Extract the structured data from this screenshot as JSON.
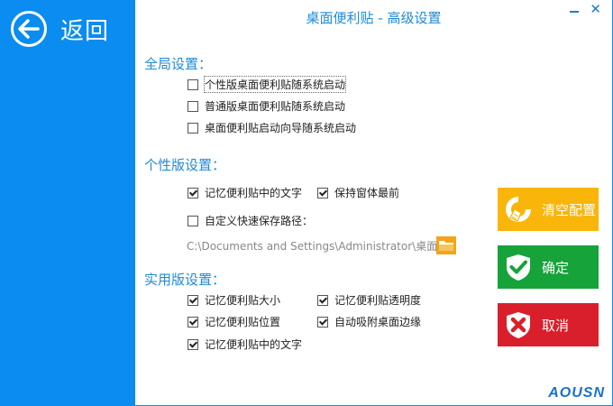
{
  "sidebar": {
    "back_label": "返回"
  },
  "window": {
    "title": "桌面便利贴 - 高级设置",
    "minimize_glyph": "–",
    "close_glyph": "✕"
  },
  "global_settings": {
    "title": "全局设置：",
    "items": [
      {
        "label": "个性版桌面便利贴随系统启动",
        "checked": false
      },
      {
        "label": "普通版桌面便利贴随系统启动",
        "checked": false
      },
      {
        "label": "桌面便利贴启动向导随系统启动",
        "checked": false
      }
    ]
  },
  "personal_settings": {
    "title": "个性版设置：",
    "items": [
      {
        "label": "记忆便利贴中的文字",
        "checked": true
      },
      {
        "label": "保持窗体最前",
        "checked": true
      },
      {
        "label": "自定义快速保存路径：",
        "checked": false
      }
    ],
    "save_path": "C:\\Documents and Settings\\Administrator\\桌面"
  },
  "practical_settings": {
    "title": "实用版设置：",
    "items": [
      {
        "label": "记忆便利贴大小",
        "checked": true
      },
      {
        "label": "记忆便利贴透明度",
        "checked": true
      },
      {
        "label": "记忆便利贴位置",
        "checked": true
      },
      {
        "label": "自动吸附桌面边缘",
        "checked": true
      },
      {
        "label": "记忆便利贴中的文字",
        "checked": true
      }
    ]
  },
  "buttons": {
    "clear_label": "清空配置",
    "ok_label": "确定",
    "cancel_label": "取消"
  },
  "brand": {
    "logo_text": "AOUSN"
  },
  "colors": {
    "sidebar": "#0a8cf0",
    "accent_text": "#1f8ad8",
    "clear_button": "#f9b50a",
    "ok_button": "#15a33a",
    "cancel_button": "#d91f2b"
  },
  "icons": {
    "back": "arrow-left-circle-icon",
    "folder": "folder-icon",
    "clear": "broom-icon",
    "ok": "checkmark-shield-icon",
    "cancel": "x-shield-icon"
  }
}
